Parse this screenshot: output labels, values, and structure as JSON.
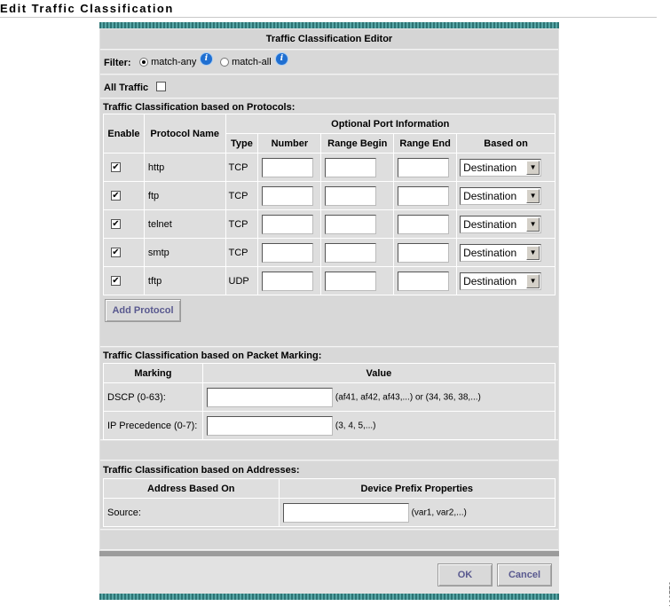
{
  "page": {
    "title": "Edit Traffic Classification",
    "side_id": "138778"
  },
  "editor": {
    "header": "Traffic Classification Editor",
    "filter_label": "Filter:",
    "filter_options": [
      "match-any",
      "match-all"
    ],
    "filter_selected": "match-any",
    "all_traffic_label": "All Traffic"
  },
  "protocols": {
    "section_title": "Traffic Classification based on Protocols:",
    "headers": {
      "enable": "Enable",
      "protocol_name": "Protocol Name",
      "optional_port": "Optional Port Information",
      "type": "Type",
      "number": "Number",
      "range_begin": "Range Begin",
      "range_end": "Range End",
      "based_on": "Based on"
    },
    "rows": [
      {
        "name": "http",
        "type": "TCP",
        "enabled": true,
        "based_on": "Destination"
      },
      {
        "name": "ftp",
        "type": "TCP",
        "enabled": true,
        "based_on": "Destination"
      },
      {
        "name": "telnet",
        "type": "TCP",
        "enabled": true,
        "based_on": "Destination"
      },
      {
        "name": "smtp",
        "type": "TCP",
        "enabled": true,
        "based_on": "Destination"
      },
      {
        "name": "tftp",
        "type": "UDP",
        "enabled": true,
        "based_on": "Destination"
      }
    ],
    "add_button": "Add Protocol"
  },
  "marking": {
    "section_title": "Traffic Classification based on Packet Marking:",
    "headers": {
      "marking": "Marking",
      "value": "Value"
    },
    "rows": [
      {
        "label": "DSCP (0-63):",
        "hint": "(af41, af42, af43,...) or (34, 36, 38,...)"
      },
      {
        "label": "IP Precedence (0-7):",
        "hint": "(3, 4, 5,...)"
      }
    ]
  },
  "addresses": {
    "section_title": "Traffic Classification based on Addresses:",
    "headers": {
      "address_based_on": "Address Based On",
      "device_prefix": "Device Prefix Properties"
    },
    "rows": [
      {
        "label": "Source:",
        "hint": "(var1, var2,...)"
      }
    ]
  },
  "buttons": {
    "ok": "OK",
    "cancel": "Cancel"
  }
}
